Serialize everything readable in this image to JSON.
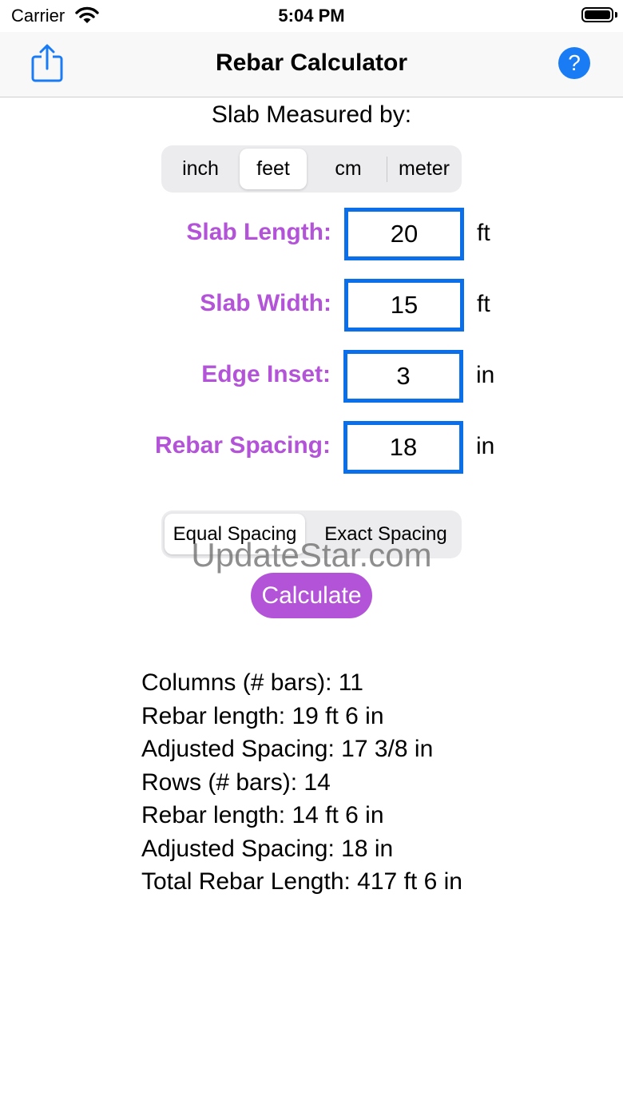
{
  "status_bar": {
    "carrier": "Carrier",
    "time": "5:04 PM"
  },
  "nav": {
    "title": "Rebar Calculator",
    "help_label": "?"
  },
  "units": {
    "label": "Slab Measured by:",
    "options": [
      "inch",
      "feet",
      "cm",
      "meter"
    ],
    "selected": "feet"
  },
  "fields": [
    {
      "label": "Slab Length:",
      "value": "20",
      "unit": "ft"
    },
    {
      "label": "Slab Width:",
      "value": "15",
      "unit": "ft"
    },
    {
      "label": "Edge Inset:",
      "value": "3",
      "unit": "in"
    },
    {
      "label": "Rebar Spacing:",
      "value": "18",
      "unit": "in"
    }
  ],
  "spacing": {
    "options": [
      "Equal Spacing",
      "Exact Spacing"
    ],
    "selected": "Equal Spacing"
  },
  "watermark": "UpdateStar.com",
  "calculate_label": "Calculate",
  "results": [
    "Columns (# bars): 11",
    "Rebar length: 19 ft 6 in",
    "Adjusted Spacing: 17 3/8 in",
    "Rows (# bars): 14",
    "Rebar length: 14 ft 6 in",
    "Adjusted Spacing: 18 in",
    "Total Rebar Length: 417 ft 6 in"
  ],
  "colors": {
    "accent": "#b354d8",
    "field_border": "#0a6fe8",
    "help_button": "#1a7cf4"
  },
  "icons": [
    "wifi-icon",
    "battery-icon",
    "share-icon",
    "help-icon"
  ]
}
